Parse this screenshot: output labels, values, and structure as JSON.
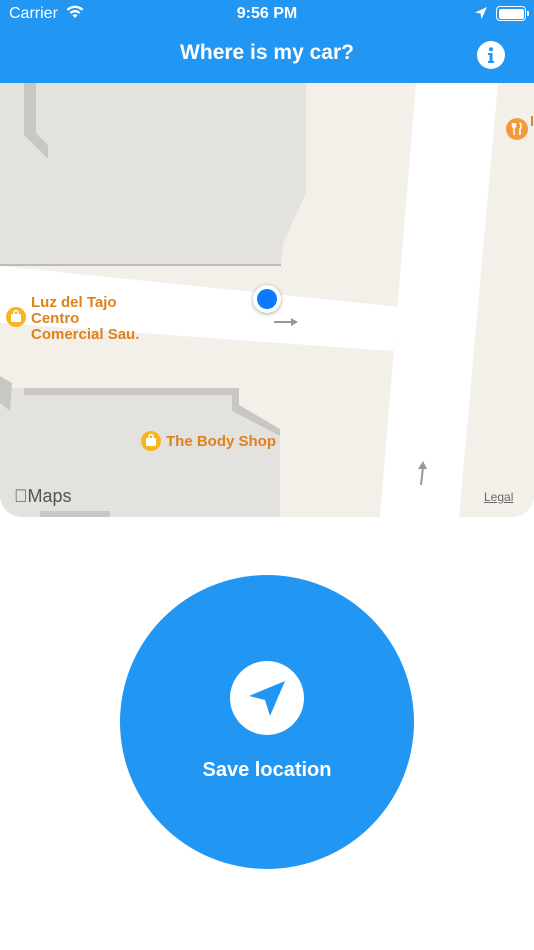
{
  "status_bar": {
    "carrier": "Carrier",
    "time": "9:56 PM"
  },
  "header": {
    "title": "Where is my car?",
    "info_icon": "info-icon"
  },
  "map": {
    "pois": [
      {
        "name_lines": [
          "Luz del Tajo",
          "Centro",
          "Comercial Sau."
        ],
        "icon": "shopping-bag-icon"
      },
      {
        "name": "The Body Shop",
        "icon": "shopping-bag-icon"
      },
      {
        "name_partial": "l",
        "icon": "fork-knife-icon"
      }
    ],
    "attribution": "Maps",
    "legal": "Legal"
  },
  "action": {
    "save_label": "Save location",
    "icon": "location-arrow-icon"
  },
  "colors": {
    "primary": "#2196f3",
    "user_location": "#0a7bff",
    "poi_label": "#e0811b",
    "poi_icon": "#f7b51f"
  }
}
